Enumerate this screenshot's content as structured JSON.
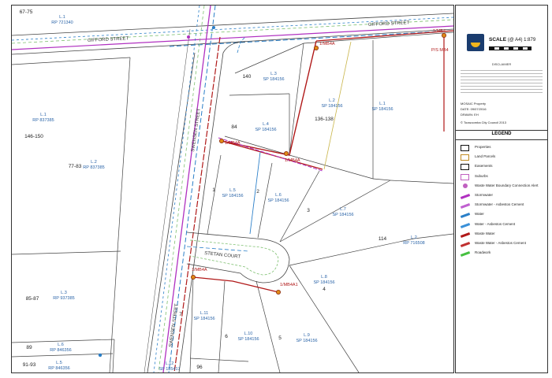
{
  "map": {
    "streets": {
      "gifford_street_west": "GIFFORD STREET",
      "gifford_street_east": "GIFFORD STREET",
      "swensen_street_north": "SWENSEN STREET",
      "swensen_street_south": "SWENSEN STREET",
      "stetan_court": "STETAN COURT"
    },
    "markers": {
      "mb4a_top": "1/MB4A",
      "mb4a_top_right": "1/MB4",
      "ps_mb4": "P/S MB4",
      "mb4a_mid_left": "1/MB4A",
      "mb4a_mid": "1/MB4A",
      "mb4a_court": "1/MB4A",
      "mb4a1_court": "1/MB4A1"
    },
    "lots": [
      {
        "id": "lot-l1-rp721340",
        "lot": "L.1",
        "plan": "RP 721340",
        "num": "67-75"
      },
      {
        "id": "lot-l1-rp837385",
        "lot": "L.1",
        "plan": "RP 837385",
        "num": "146-150"
      },
      {
        "id": "lot-l2-rp837385",
        "lot": "L.2",
        "plan": "RP 837385",
        "num": "77-83"
      },
      {
        "id": "lot-l3-rp937385",
        "lot": "L.3",
        "plan": "RP 937385",
        "num": "85-87"
      },
      {
        "id": "lot-l6-rp846356",
        "lot": "L.6",
        "plan": "RP 846356",
        "num": "89"
      },
      {
        "id": "lot-l5-rp846356",
        "lot": "L.5",
        "plan": "RP 846356",
        "num": "91-93"
      },
      {
        "id": "lot-l3-sp184156",
        "lot": "L.3",
        "plan": "SP 184156",
        "num": "140"
      },
      {
        "id": "lot-l4-sp184156",
        "lot": "L.4",
        "plan": "SP 184156",
        "num": "84"
      },
      {
        "id": "lot-l2-sp184156",
        "lot": "L.2",
        "plan": "SP 184156",
        "num": "136-138"
      },
      {
        "id": "lot-l1-sp184156",
        "lot": "L.1",
        "plan": "SP 184156",
        "num": ""
      },
      {
        "id": "lot-l5-sp184156",
        "lot": "L.5",
        "plan": "SP 184156",
        "num": "1"
      },
      {
        "id": "lot-l6-sp184156",
        "lot": "L.6",
        "plan": "SP 184156",
        "num": "2"
      },
      {
        "id": "lot-l7-sp184156",
        "lot": "L.7",
        "plan": "SP 184156",
        "num": "3"
      },
      {
        "id": "lot-l2-rp716508",
        "lot": "L.2",
        "plan": "RP 716508",
        "num": "114"
      },
      {
        "id": "lot-l8-sp184156",
        "lot": "L.8",
        "plan": "SP 184156",
        "num": "4"
      },
      {
        "id": "lot-l11-sp184156",
        "lot": "L.11",
        "plan": "SP 184156",
        "num": "7"
      },
      {
        "id": "lot-l10-sp184156",
        "lot": "L.10",
        "plan": "SP 184156",
        "num": "6"
      },
      {
        "id": "lot-l9-sp184156",
        "lot": "L.9",
        "plan": "SP 184156",
        "num": "5"
      },
      {
        "id": "lot-l12-sp185417",
        "lot": "L.12",
        "plan": "SP 185417",
        "num": "96"
      }
    ]
  },
  "panel": {
    "scale_label": "SCALE",
    "scale_paper": "(@ A4)",
    "scale_value": "1:879",
    "disclaimer_title": "DISCLAIMER",
    "info_1": "MOSAIC Property",
    "info_2": "DATE: 09/07/2016",
    "info_3": "DRAWN: EH",
    "copyright": "© Toowoomba City Council 2013",
    "legend_title": "LEGEND",
    "legend": [
      {
        "label": "Properties",
        "color": "#111111",
        "style": "box"
      },
      {
        "label": "Land Parcels",
        "color": "#c08a20",
        "style": "box"
      },
      {
        "label": "Easements",
        "color": "#111111",
        "style": "box"
      },
      {
        "label": "Suburbs",
        "color": "#c060c0",
        "style": "box"
      },
      {
        "label": "Waste Water Boundary Connection Alert",
        "color": "#c060c0",
        "style": "dot"
      },
      {
        "label": "Stormwater",
        "color": "#b030c0",
        "style": "line"
      },
      {
        "label": "Stormwater - Asbestos Cement",
        "color": "#c060d0",
        "style": "line"
      },
      {
        "label": "Water",
        "color": "#2a7fc8",
        "style": "line"
      },
      {
        "label": "Water - Asbestos Cement",
        "color": "#3a90d8",
        "style": "line"
      },
      {
        "label": "Waste Water",
        "color": "#b01818",
        "style": "line"
      },
      {
        "label": "Waste Water - Asbestos Cement",
        "color": "#c03030",
        "style": "line"
      },
      {
        "label": "Roadwork",
        "color": "#46c040",
        "style": "line"
      }
    ]
  }
}
